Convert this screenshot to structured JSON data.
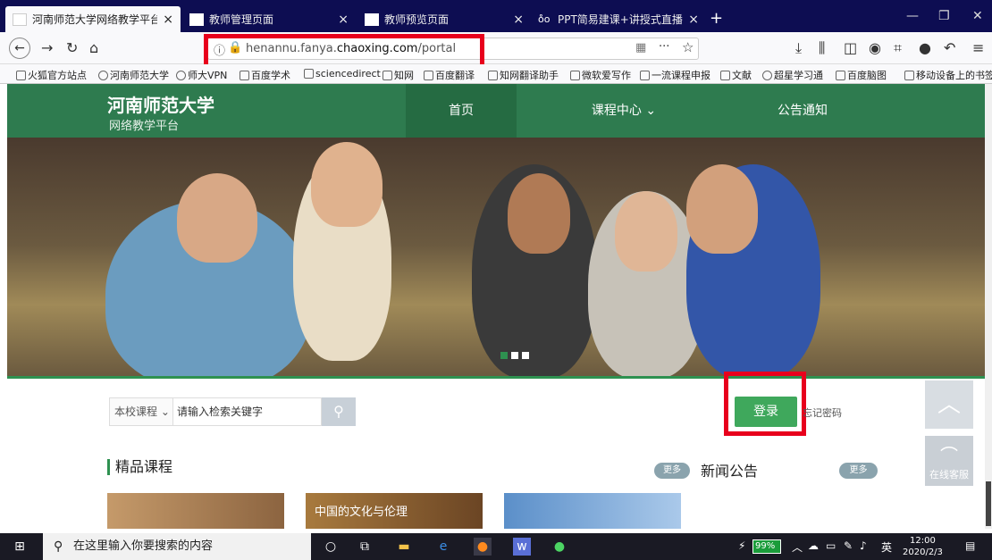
{
  "tabs": [
    {
      "title": "河南师范大学网络教学平台",
      "active": true
    },
    {
      "title": "教师管理页面",
      "active": false
    },
    {
      "title": "教师预览页面",
      "active": false
    },
    {
      "title": "PPT简易建课+讲授式直播 - 百",
      "active": false
    }
  ],
  "url": {
    "prefix": "henannu.fanya.",
    "domain": "chaoxing.com",
    "path": "/portal"
  },
  "bookmarks": [
    "火狐官方站点",
    "河南师范大学",
    "师大VPN",
    "百度学术",
    "sciencedirect",
    "知网",
    "百度翻译",
    "知网翻译助手",
    "微软爱写作",
    "一流课程申报",
    "文献",
    "超星学习通",
    "百度脑图",
    "移动设备上的书签"
  ],
  "site": {
    "logo_title": "河南师范大学",
    "logo_subtitle": "网络教学平台",
    "menu": [
      {
        "label": "首页",
        "active": true
      },
      {
        "label": "课程中心 ⌄",
        "active": false
      },
      {
        "label": "公告通知",
        "active": false
      }
    ],
    "search_scope": "本校课程 ⌄",
    "search_placeholder": "请输入检索关键字",
    "login_label": "登录",
    "forgot_label": "忘记密码",
    "section_courses": "精品课程",
    "section_news": "新闻公告",
    "more_label": "更多",
    "service_label": "在线客服",
    "course_titles": [
      "",
      "中国的文化与伦理",
      ""
    ]
  },
  "taskbar": {
    "search_placeholder": "在这里输入你要搜索的内容",
    "battery": "99%",
    "ime": "英",
    "time": "12:00",
    "date": "2020/2/3"
  },
  "colors": {
    "header": "#2e7b4f",
    "login": "#3fa85c",
    "highlight": "#e8001c",
    "tabbar": "#0d0d52"
  }
}
